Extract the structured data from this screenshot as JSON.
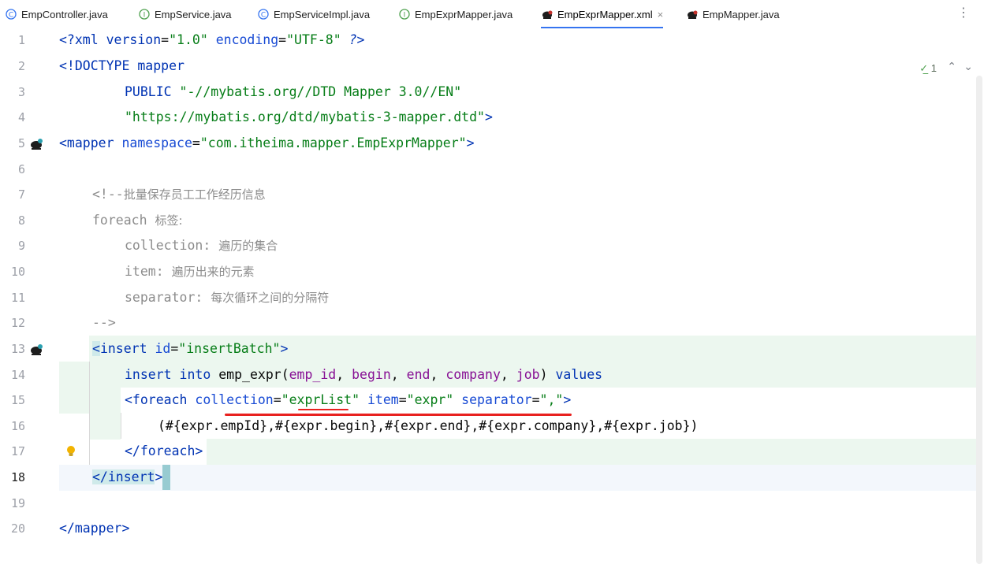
{
  "tabs": [
    {
      "label": "EmpController.java",
      "icon": "class-icon"
    },
    {
      "label": "EmpService.java",
      "icon": "interface-icon"
    },
    {
      "label": "EmpServiceImpl.java",
      "icon": "class-icon"
    },
    {
      "label": "EmpExprMapper.java",
      "icon": "interface-icon"
    },
    {
      "label": "EmpExprMapper.xml",
      "icon": "mybatis-icon",
      "active": true
    },
    {
      "label": "EmpMapper.java",
      "icon": "mybatis-icon"
    }
  ],
  "inspection": {
    "count": "1"
  },
  "lines": [
    {
      "n": "1"
    },
    {
      "n": "2"
    },
    {
      "n": "3"
    },
    {
      "n": "4"
    },
    {
      "n": "5"
    },
    {
      "n": "6"
    },
    {
      "n": "7"
    },
    {
      "n": "8"
    },
    {
      "n": "9"
    },
    {
      "n": "10"
    },
    {
      "n": "11"
    },
    {
      "n": "12"
    },
    {
      "n": "13"
    },
    {
      "n": "14"
    },
    {
      "n": "15"
    },
    {
      "n": "16"
    },
    {
      "n": "17"
    },
    {
      "n": "18"
    },
    {
      "n": "19"
    },
    {
      "n": "20"
    }
  ],
  "code": {
    "l1_a": "<?",
    "l1_b": "xml version",
    "l1_c": "=",
    "l1_d": "\"1.0\"",
    "l1_e": " encoding",
    "l1_f": "=",
    "l1_g": "\"UTF-8\"",
    "l1_h": " ?>",
    "l2": "<!DOCTYPE mapper",
    "l3_a": "PUBLIC ",
    "l3_b": "\"-//mybatis.org//DTD Mapper 3.0//EN\"",
    "l4_a": "\"https://mybatis.org/dtd/mybatis-3-mapper.dtd\"",
    "l4_b": ">",
    "l5_a": "<mapper ",
    "l5_b": "namespace",
    "l5_c": "=",
    "l5_d": "\"com.itheima.mapper.EmpExprMapper\"",
    "l5_e": ">",
    "l7_a": "<!--",
    "l7_b": "批量保存员工工作经历信息",
    "l8_a": "foreach ",
    "l8_b": "标签:",
    "l9_a": "collection: ",
    "l9_b": "遍历的集合",
    "l10_a": "item: ",
    "l10_b": "遍历出来的元素",
    "l11_a": "separator: ",
    "l11_b": "每次循环之间的分隔符",
    "l12": "-->",
    "l13_a": "<",
    "l13_b": "insert",
    "l13_c": " id",
    "l13_d": "=",
    "l13_e": "\"insertBatch\"",
    "l13_f": ">",
    "l14_a": "insert into ",
    "l14_b": "emp_expr(",
    "l14_c": "emp_id",
    "l14_d": ", ",
    "l14_e": "begin",
    "l14_f": ", ",
    "l14_g": "end",
    "l14_h": ", ",
    "l14_i": "company",
    "l14_j": ", ",
    "l14_k": "job",
    "l14_l": ") ",
    "l14_m": "values",
    "l15_a": "<foreach ",
    "l15_b": "collection",
    "l15_c": "=",
    "l15_d": "\"exprList\"",
    "l15_e": " item",
    "l15_f": "=",
    "l15_g": "\"expr\"",
    "l15_h": " separator",
    "l15_i": "=",
    "l15_j": "\",\"",
    "l15_k": ">",
    "l16": "(#{expr.empId},#{expr.begin},#{expr.end},#{expr.company},#{expr.job})",
    "l17_a": "</",
    "l17_b": "foreach",
    "l17_c": ">",
    "l18_a": "</",
    "l18_b": "insert",
    "l18_c": ">",
    "l20": "</mapper>"
  }
}
